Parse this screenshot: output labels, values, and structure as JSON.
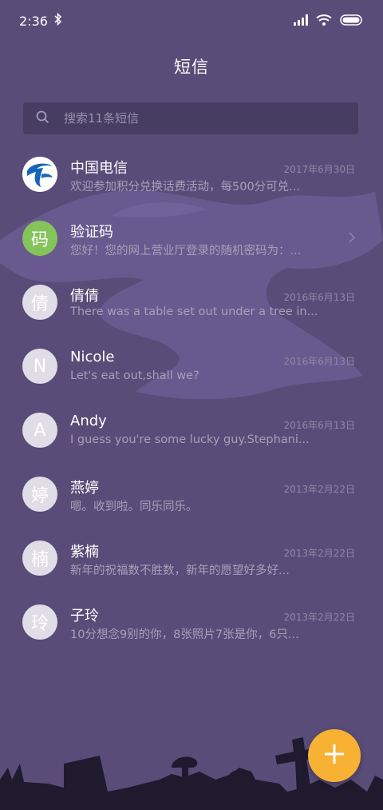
{
  "status_bar": {
    "time": "2:36"
  },
  "header": {
    "title": "短信"
  },
  "search": {
    "placeholder": "搜索11条短信"
  },
  "conversations": [
    {
      "name": "中国电信",
      "preview": "欢迎参加积分兑换话费活动，每500分可兑...",
      "date": "2017年6月30日",
      "avatar": "telecom-logo"
    },
    {
      "name": "验证码",
      "preview": "您好！您的网上营业厅登录的随机密码为：...",
      "avatar_text": "码"
    },
    {
      "name": "倩倩",
      "preview": "There was a table set out under a tree in...",
      "date": "2016年6月13日",
      "avatar_text": "倩"
    },
    {
      "name": "Nicole",
      "preview": "Let's eat out,shall we?",
      "date": "2016年6月13日",
      "avatar_text": "N"
    },
    {
      "name": "Andy",
      "preview": "I guess you're some lucky guy.Stephani...",
      "date": "2016年6月13日",
      "avatar_text": "A"
    },
    {
      "name": "燕婷",
      "preview": "嗯。收到啦。同乐同乐。",
      "date": "2013年2月22日",
      "avatar_text": "婷"
    },
    {
      "name": "紫楠",
      "preview": "新年的祝福数不胜数，新年的愿望好多好...",
      "date": "2013年2月22日",
      "avatar_text": "楠"
    },
    {
      "name": "子玲",
      "preview": "10分想念9别的你，8张照片7张是你，6只...",
      "date": "2013年2月22日",
      "avatar_text": "玲"
    }
  ],
  "colors": {
    "background": "#5a4c78",
    "fab": "#f7b234",
    "search_bg": "#473c61"
  }
}
